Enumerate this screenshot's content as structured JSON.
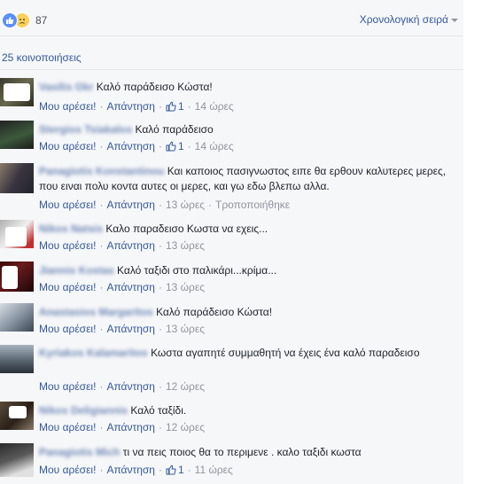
{
  "reactions": {
    "count": "87"
  },
  "sort": {
    "label": "Χρονολογική σειρά"
  },
  "shares": {
    "label": "25 κοινοποιήσεις"
  },
  "actions": {
    "like": "Μου αρέσει!",
    "reply": "Απάντηση",
    "edited": "Τροποποιήθηκε",
    "sep": "·"
  },
  "comments": [
    {
      "name": "Vasilis Gkr",
      "text": "Καλό παράδεισο Κώστα!",
      "likes": "1",
      "time": "14 ώρες"
    },
    {
      "name": "Stergios Tsiakalos",
      "text": "Καλό παράδεισο",
      "likes": "1",
      "time": "14 ώρες"
    },
    {
      "name": "Panagiotis Konstantinou",
      "text": "Και καποιος πασιγνωστος ειπε θα ερθουν καλυτερες μερες, που ειναι πολυ κοντα αυτες οι μερες, και γω εδω βλεπω αλλα.",
      "time": "13 ώρες"
    },
    {
      "name": "Nikos Natsis",
      "text": "Καλο παραδεισο Κωστα να εχεις...",
      "time": "13 ώρες"
    },
    {
      "name": "Jiannis Kostas",
      "text": "Καλό ταξιδι στο παλικάρι...κρίμα...",
      "time": "13 ώρες"
    },
    {
      "name": "Anastasios Margaritos",
      "text": "Καλό παράδεισο Κώστα!",
      "time": "13 ώρες"
    },
    {
      "name": "Kyriakos Kalamaritos",
      "text": "Κωστα αγαπητέ συμμαθητή να έχεις ένα καλό παραδεισο",
      "time": "12 ώρες"
    },
    {
      "name": "Nikos Deligiannis",
      "text": "Καλό ταξίδι.",
      "time": "12 ώρες"
    },
    {
      "name": "Panagiotis Mich",
      "text": "τι να πεις ποιος θα το περιμενε . καλο ταξιδι κωστα",
      "likes": "1",
      "time": "11 ώρες"
    }
  ]
}
